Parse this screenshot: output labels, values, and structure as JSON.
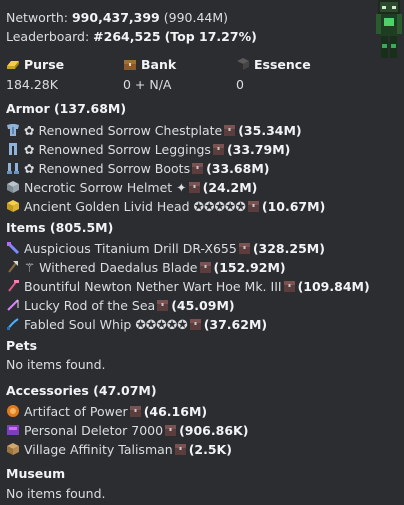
{
  "header": {
    "networth_label": "Networth:",
    "networth_value": "990,437,399",
    "networth_short": "(990.44M)",
    "leaderboard_label": "Leaderboard:",
    "leaderboard_rank": "#264,525",
    "leaderboard_top": "(Top 17.27%)"
  },
  "stats": [
    {
      "label": "Purse",
      "value": "184.28K",
      "icon": "gold-ingot-icon"
    },
    {
      "label": "Bank",
      "value": "0 + N/A",
      "icon": "bank-chest-icon"
    },
    {
      "label": "Essence",
      "value": "0",
      "icon": "essence-cube-icon"
    }
  ],
  "armor": {
    "heading": "Armor (137.68M)",
    "items": [
      {
        "prefix": "✿ ",
        "name": "Renowned Sorrow Chestplate",
        "value": "(35.34M)",
        "icon": "chestplate-icon"
      },
      {
        "prefix": "✿ ",
        "name": "Renowned Sorrow Leggings",
        "value": "(33.79M)",
        "icon": "leggings-icon"
      },
      {
        "prefix": "✿ ",
        "name": "Renowned Sorrow Boots",
        "value": "(33.68M)",
        "icon": "boots-icon"
      },
      {
        "prefix": "",
        "name": "Necrotic Sorrow Helmet ✦",
        "value": "(24.2M)",
        "icon": "helmet-icon"
      },
      {
        "prefix": "",
        "name": "Ancient Golden Livid Head ✪✪✪✪✪",
        "value": "(10.67M)",
        "icon": "golden-head-icon"
      }
    ]
  },
  "items": {
    "heading": "Items (805.5M)",
    "items": [
      {
        "name": "Auspicious Titanium Drill DR-X655",
        "value": "(328.25M)",
        "icon": "drill-icon"
      },
      {
        "name": "⚚ Withered Daedalus Blade",
        "value": "(152.92M)",
        "icon": "axe-icon"
      },
      {
        "name": "Bountiful Newton Nether Wart Hoe Mk. III",
        "value": "(109.84M)",
        "icon": "hoe-icon"
      },
      {
        "name": "Lucky Rod of the Sea",
        "value": "(45.09M)",
        "icon": "fishing-rod-icon"
      },
      {
        "name": "Fabled Soul Whip ✪✪✪✪✪",
        "value": "(37.62M)",
        "icon": "whip-icon"
      }
    ]
  },
  "pets": {
    "heading": "Pets",
    "empty": "No items found."
  },
  "accessories": {
    "heading": "Accessories (47.07M)",
    "items": [
      {
        "name": "Artifact of Power",
        "value": "(46.16M)",
        "icon": "artifact-icon"
      },
      {
        "name": "Personal Deletor 7000",
        "value": "(906.86K)",
        "icon": "deletor-icon"
      },
      {
        "name": "Village Affinity Talisman",
        "value": "(2.5K)",
        "icon": "talisman-icon"
      }
    ]
  },
  "museum": {
    "heading": "Museum",
    "empty": "No items found."
  },
  "colors": {
    "background": "#2b2d31",
    "text": "#dbdee1",
    "bold_text": "#f2f3f5"
  }
}
